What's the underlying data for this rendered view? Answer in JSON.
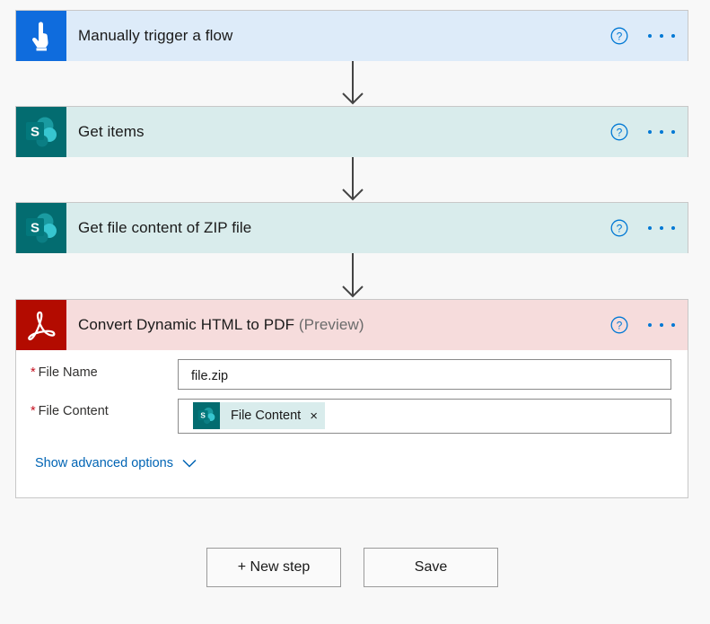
{
  "steps": [
    {
      "title": "Manually trigger a flow",
      "icon": "touch-icon",
      "header_bg": "#ddebf9",
      "icon_bg": "#0f6cdd"
    },
    {
      "title": "Get items",
      "icon": "sharepoint-icon",
      "header_bg": "#d9ecec",
      "icon_bg": "#036c70"
    },
    {
      "title": "Get file content of ZIP file",
      "icon": "sharepoint-icon",
      "header_bg": "#d9ecec",
      "icon_bg": "#036c70"
    },
    {
      "title": "Convert Dynamic HTML to PDF",
      "title_suffix": "(Preview)",
      "icon": "adobe-acrobat-icon",
      "header_bg": "#f6dcdc",
      "icon_bg": "#b30b00"
    }
  ],
  "fields": {
    "file_name": {
      "label": "File Name",
      "required": "*",
      "value": "file.zip"
    },
    "file_content": {
      "label": "File Content",
      "required": "*",
      "token_label": "File Content",
      "token_close": "×"
    }
  },
  "advanced_options_label": "Show advanced options",
  "buttons": {
    "new_step": "+ New step",
    "save": "Save"
  },
  "colors": {
    "accent": "#0078d4",
    "link": "#0064b4",
    "required": "#c50f1f"
  }
}
